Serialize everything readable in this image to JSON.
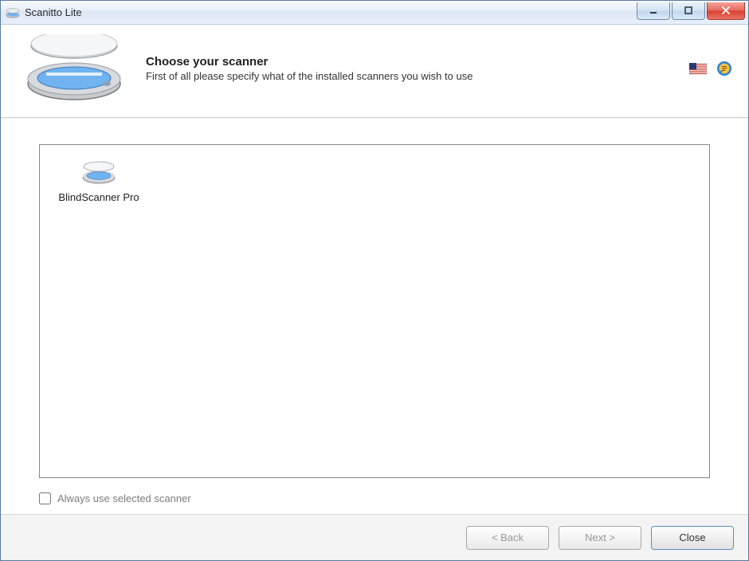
{
  "window": {
    "title": "Scanitto Lite"
  },
  "header": {
    "heading": "Choose your scanner",
    "subheading": "First of all please specify what of the installed scanners you wish to use"
  },
  "scanners": {
    "items": [
      {
        "label": "BlindScanner Pro"
      }
    ]
  },
  "options": {
    "always_use_label": "Always use selected scanner",
    "always_use_checked": false
  },
  "footer": {
    "back_label": "< Back",
    "next_label": "Next >",
    "close_label": "Close",
    "back_enabled": false,
    "next_enabled": false
  },
  "icons": {
    "language": "us-flag",
    "help": "help-bubble"
  },
  "colors": {
    "scanner_body": "#c8cbce",
    "scanner_glass": "#6fb3f0",
    "scanner_lid": "#e8ebee",
    "flag_red": "#c0392b",
    "flag_blue": "#2a3a78",
    "help_outer": "#2a86d6",
    "help_inner": "#f5c242"
  }
}
